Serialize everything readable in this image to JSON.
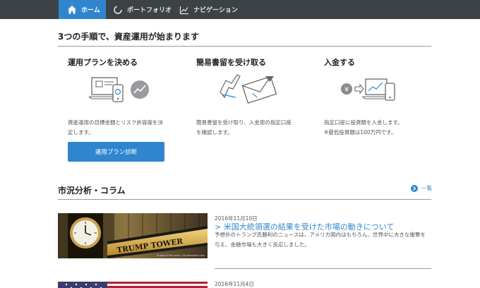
{
  "nav": {
    "tabs": [
      {
        "label": "ホーム",
        "icon": "home-icon",
        "active": true
      },
      {
        "label": "ポートフォリオ",
        "icon": "portfolio-icon",
        "active": false
      },
      {
        "label": "ナビゲーション",
        "icon": "navigation-icon",
        "active": false
      }
    ]
  },
  "steps_section": {
    "title": "3つの手順で、資産運用が始まります",
    "steps": [
      {
        "title": "運用プランを決める",
        "desc": [
          "資産運用の目標金額とリスク許容度を決",
          "定します。"
        ],
        "illustration": "device-chart-illustration"
      },
      {
        "title": "簡易書留を受け取る",
        "desc": [
          "簡易書留を受け取り、入金用の指定口座",
          "を確認します。"
        ],
        "illustration": "envelope-sign-illustration"
      },
      {
        "title": "入金する",
        "desc": [
          "指定口座に投資額を入金します。",
          "※最低投資額は100万円です。"
        ],
        "illustration": "yen-transfer-illustration"
      }
    ],
    "button_label": "運用プラン診断"
  },
  "market_section": {
    "title": "市況分析・コラム",
    "more_label": "一覧",
    "articles": [
      {
        "date": "2016年11月10日",
        "title": "> 米国大統領選の結果を受けた市場の動きについて",
        "excerpt": [
          "予想外のトランプ氏勝利のニュースは、アメリカ国内はもちろん、世界中に大きな衝撃を",
          "与え、金融市場も大きく反応しました。"
        ],
        "image": "trump-tower-photo",
        "image_sign": "TRUMP TOWER",
        "image_credit": "Angela N Perryman / Shutterstock.com"
      },
      {
        "date": "2016年11月4日",
        "image": "us-flag-photo"
      }
    ]
  },
  "colors": {
    "nav_bg": "#3c4245",
    "accent": "#2f86cf"
  }
}
